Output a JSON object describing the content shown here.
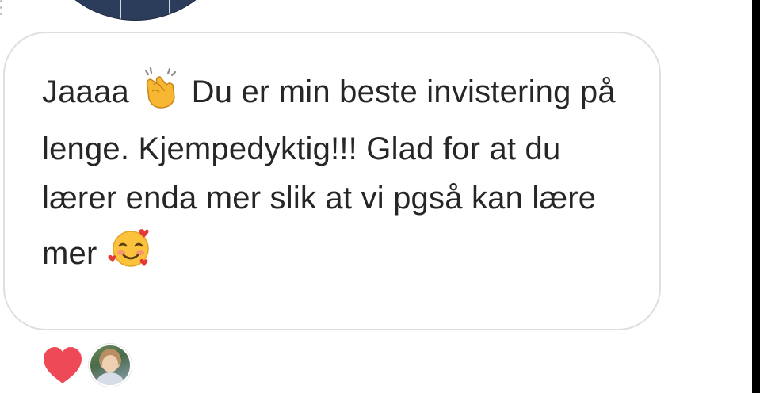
{
  "thread": {
    "message": {
      "parts": [
        {
          "type": "text",
          "value": "Jaaaa "
        },
        {
          "type": "emoji",
          "icon": "clapping-hands-icon"
        },
        {
          "type": "text",
          "value": " Du er min beste invistering på lenge. Kjempedyktig!!! Glad for at du lærer enda mer slik at vi pgså kan lære mer "
        },
        {
          "type": "emoji",
          "icon": "smiling-face-with-hearts-icon"
        }
      ]
    },
    "reaction": {
      "icon": "heart-icon",
      "color": "#ed4956"
    },
    "colors": {
      "bubble_border": "#dedede",
      "text": "#262626"
    }
  }
}
